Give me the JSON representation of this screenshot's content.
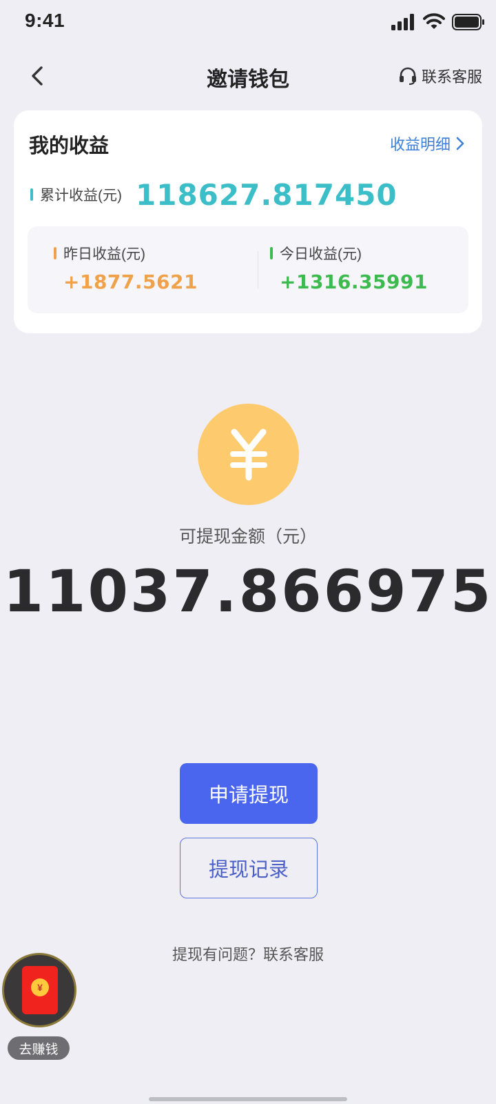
{
  "status_bar": {
    "time": "9:41"
  },
  "nav": {
    "title": "邀请钱包",
    "contact_label": "联系客服",
    "icons": {
      "back": "chevron-left-icon",
      "contact": "headset-icon"
    }
  },
  "earnings_card": {
    "title": "我的收益",
    "details_link": "收益明细",
    "total_label": "累计收益(元)",
    "total_value": "118627.817450",
    "yesterday_label": "昨日收益(元)",
    "yesterday_value": "+1877.5621",
    "today_label": "今日收益(元)",
    "today_value": "+1316.35991",
    "colors": {
      "total": "#3BBEC7",
      "yesterday": "#F0A24A",
      "today": "#3DBA4E",
      "link": "#3C7FD8"
    }
  },
  "balance": {
    "icon": "yuan-coin-icon",
    "label": "可提现金额（元）",
    "value": "11037.866975"
  },
  "actions": {
    "withdraw_label": "申请提现",
    "records_label": "提现记录",
    "help_text": "提现有问题？联系客服"
  },
  "floating_earn": {
    "icon": "red-envelope-icon",
    "seal": "¥",
    "label": "去赚钱"
  },
  "colors": {
    "primary": "#4A66EE",
    "background": "#EFEEF5",
    "coin": "#FDCB6E"
  }
}
